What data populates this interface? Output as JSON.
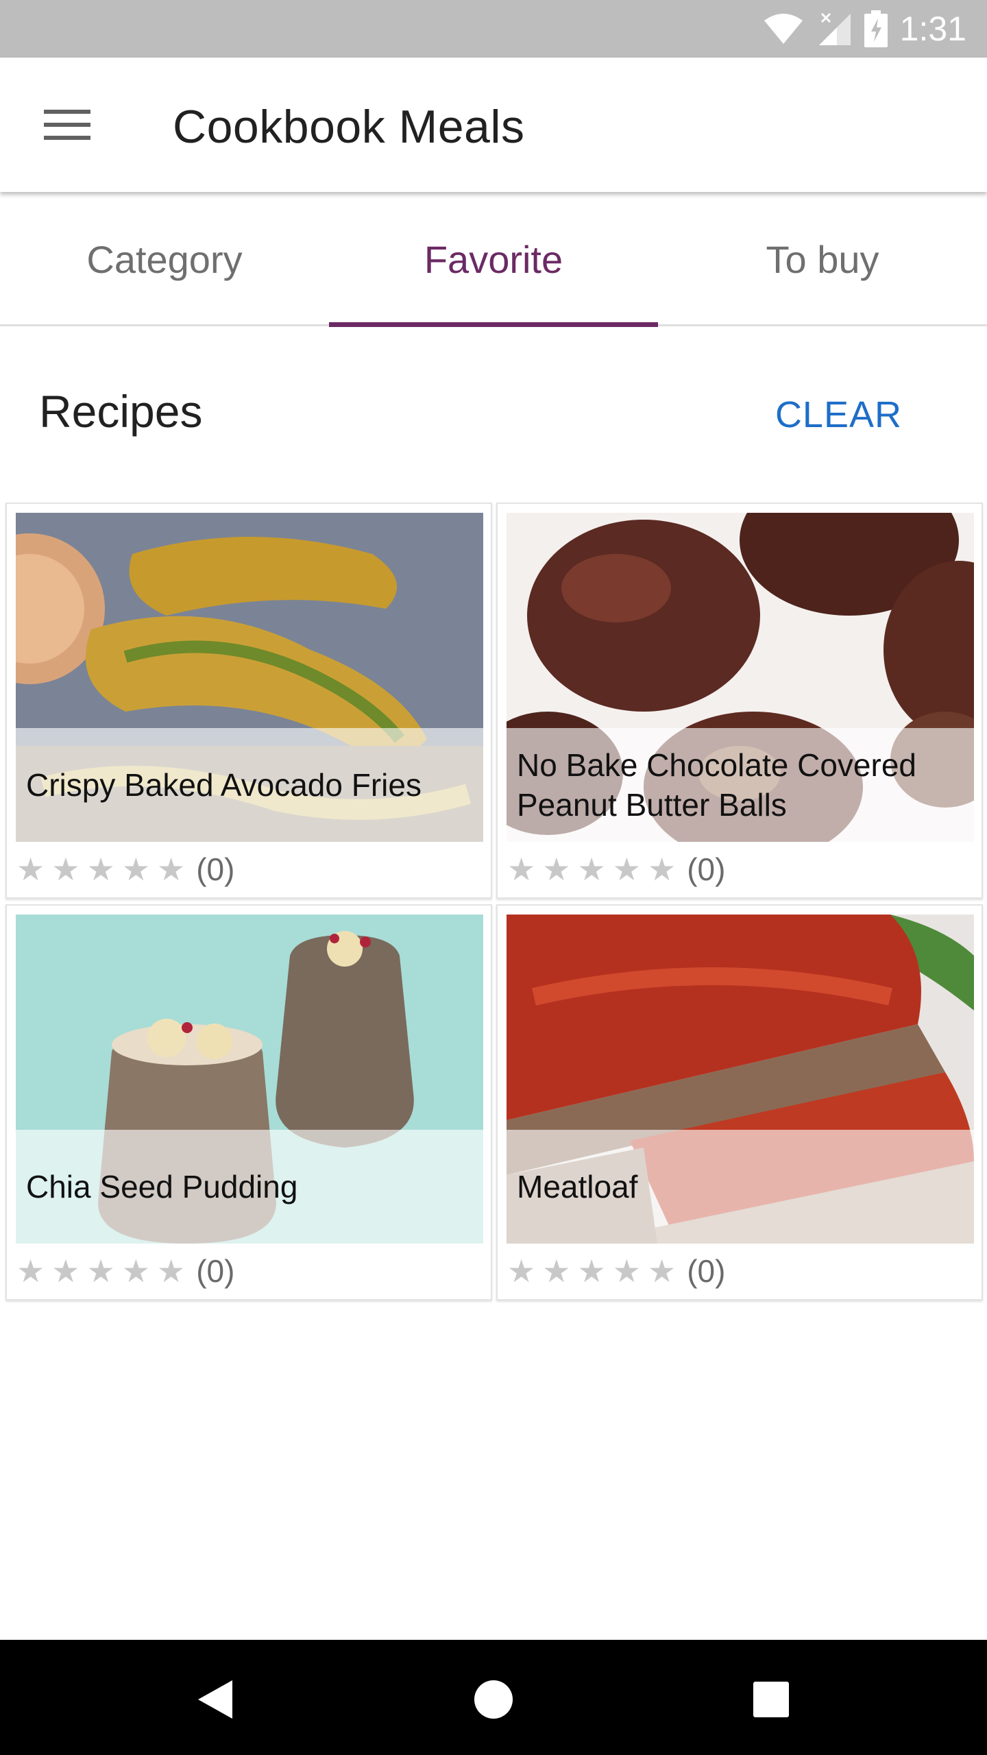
{
  "status_bar": {
    "time": "1:31"
  },
  "app_bar": {
    "title": "Cookbook Meals",
    "menu_icon": "hamburger-menu-icon"
  },
  "tabs": [
    {
      "label": "Category",
      "active": false
    },
    {
      "label": "Favorite",
      "active": true
    },
    {
      "label": "To buy",
      "active": false
    }
  ],
  "section": {
    "title": "Recipes",
    "clear_label": "CLEAR"
  },
  "recipes": [
    {
      "name": "Crispy Baked Avocado Fries",
      "stars": "★★★★★",
      "rating_count": "(0)"
    },
    {
      "name": "No Bake Chocolate Covered Peanut Butter Balls",
      "stars": "★★★★★",
      "rating_count": "(0)"
    },
    {
      "name": "Chia Seed Pudding",
      "stars": "★★★★★",
      "rating_count": "(0)"
    },
    {
      "name": "Meatloaf",
      "stars": "★★★★★",
      "rating_count": "(0)"
    }
  ],
  "colors": {
    "accent": "#6b2a64",
    "link": "#1e6ec8",
    "status_bar": "#bdbdbd"
  }
}
